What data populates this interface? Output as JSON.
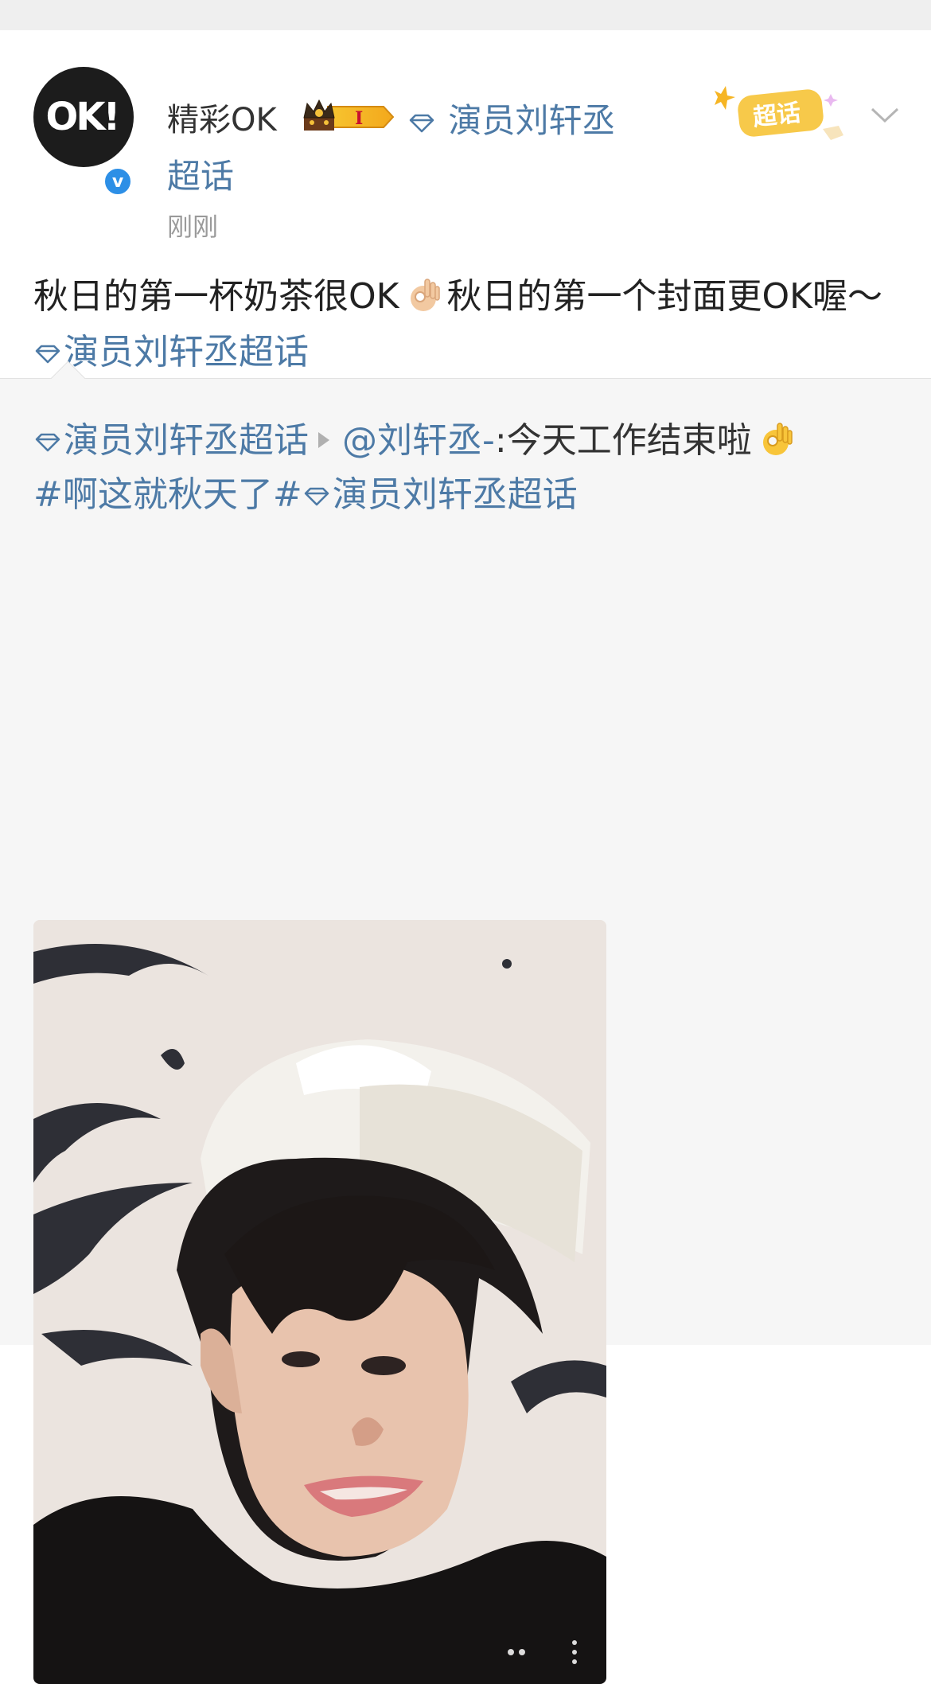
{
  "post": {
    "author": {
      "name": "精彩OK",
      "avatar_text": "OK!",
      "verified_mark": "v"
    },
    "author_topic": "演员刘轩丞",
    "author_topic_line2": "超话",
    "timestamp": "刚刚",
    "supertopic_tag": "超话",
    "body_part1": "秋日的第一杯奶茶很OK",
    "body_part2": "秋日的第一个封面更OK喔～",
    "body_link": "演员刘轩丞超话"
  },
  "repost": {
    "topic": "演员刘轩丞超话",
    "mention": "@刘轩丞-",
    "text": ":今天工作结束啦",
    "hashtag": "#啊这就秋天了#",
    "topic2": "演员刘轩丞超话",
    "photo_overlay_icon": "more-dots-icon"
  },
  "colors": {
    "link": "#4d7aa6",
    "background_repost": "#f6f6f6",
    "verified_blue": "#2d8fe6"
  }
}
